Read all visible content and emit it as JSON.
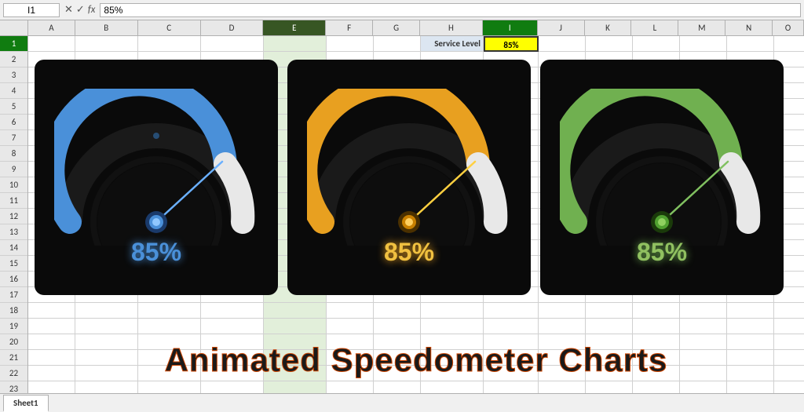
{
  "formula_bar": {
    "name_box": "I1",
    "formula_icons": [
      "✕",
      "✓",
      "fx"
    ],
    "formula_value": "85%"
  },
  "columns": [
    "A",
    "B",
    "C",
    "D",
    "E",
    "F",
    "G",
    "H",
    "I",
    "J",
    "K",
    "L",
    "M",
    "N",
    "O"
  ],
  "selected_column": "I",
  "row_count": 23,
  "cells": {
    "H1": {
      "label": "Service Level",
      "class": "service-level-label"
    },
    "I1": {
      "label": "85%",
      "class": "service-level-value"
    }
  },
  "speedometers": [
    {
      "id": "blue",
      "value": 85,
      "label": "85%",
      "color_main": "#4a90d9",
      "color_glow": "#6ab0ff",
      "color_text": "#4a90d9",
      "color_needle": "#6ab0ff",
      "color_center": "#3a80c9"
    },
    {
      "id": "gold",
      "value": 85,
      "label": "85%",
      "color_main": "#e8a020",
      "color_glow": "#ffd040",
      "color_text": "#f0c040",
      "color_needle": "#ffd040",
      "color_center": "#d09010"
    },
    {
      "id": "green",
      "value": 85,
      "label": "85%",
      "color_main": "#70b050",
      "color_glow": "#90d070",
      "color_text": "#90c060",
      "color_needle": "#80c060",
      "color_center": "#60a040"
    }
  ],
  "footer": {
    "text": "Animated Speedometer Charts"
  },
  "sheet_tabs": [
    "Sheet1"
  ]
}
